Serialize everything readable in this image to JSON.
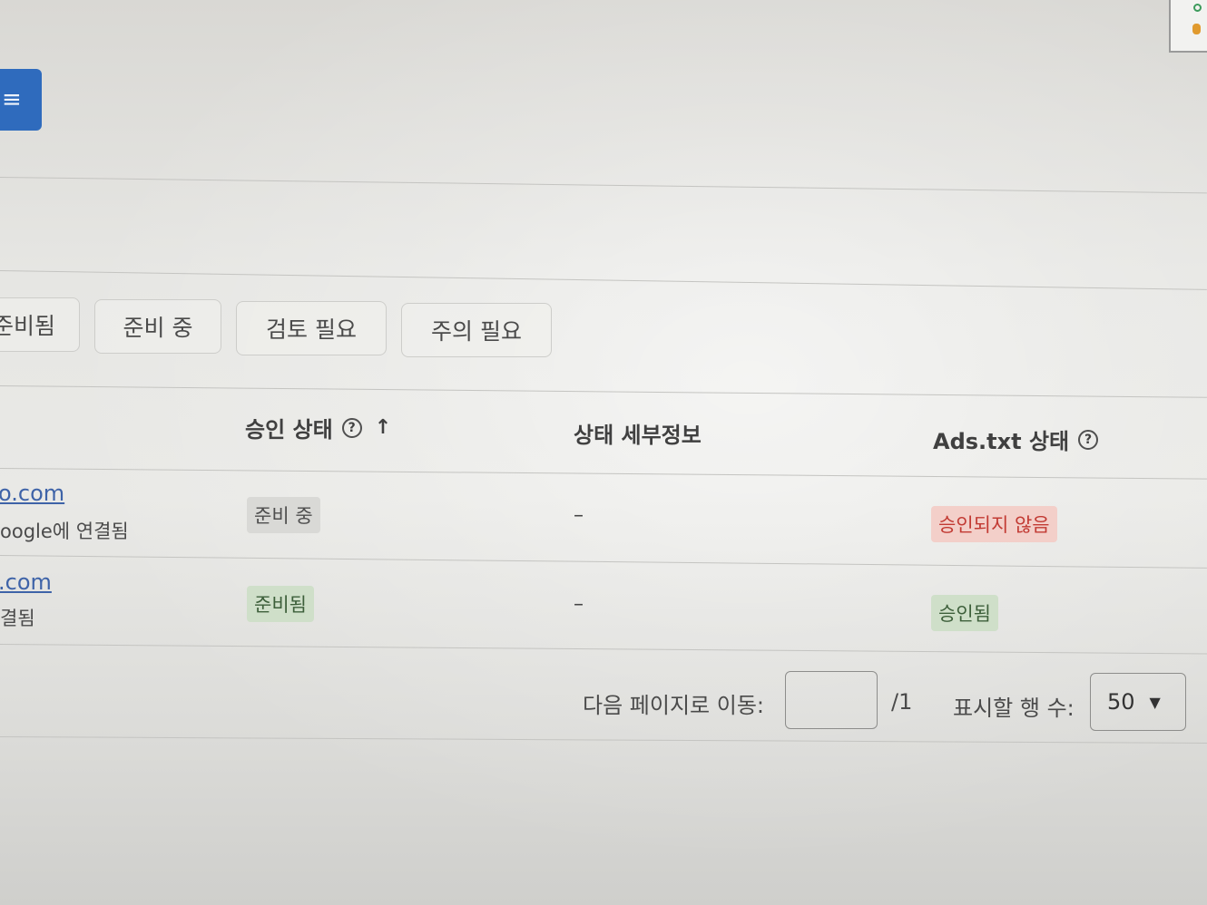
{
  "filters": {
    "chips": [
      {
        "label": "준비됨"
      },
      {
        "label": "준비 중"
      },
      {
        "label": "검토 필요"
      },
      {
        "label": "주의 필요"
      }
    ]
  },
  "table": {
    "headers": {
      "approval_status": "승인 상태",
      "status_details": "상태 세부정보",
      "ads_txt_status": "Ads.txt 상태"
    },
    "rows": [
      {
        "site": "o.com",
        "site_sub": "oogle에 연결됨",
        "approval": "준비 중",
        "details": "–",
        "ads_txt": "승인되지 않음"
      },
      {
        "site": ".com",
        "site_sub": "결됨",
        "approval": "준비됨",
        "details": "–",
        "ads_txt": "승인됨"
      }
    ]
  },
  "pagination": {
    "goto_label": "다음 페이지로 이동:",
    "page_input_value": "",
    "total_pages": "/1",
    "rows_label": "표시할 행 수:",
    "rows_value": "50"
  },
  "colors": {
    "menu_button": "#2f6bbd",
    "link": "#3e63a8",
    "badge_red_text": "#c23a33",
    "badge_green_bg": "#cfdfc9"
  }
}
